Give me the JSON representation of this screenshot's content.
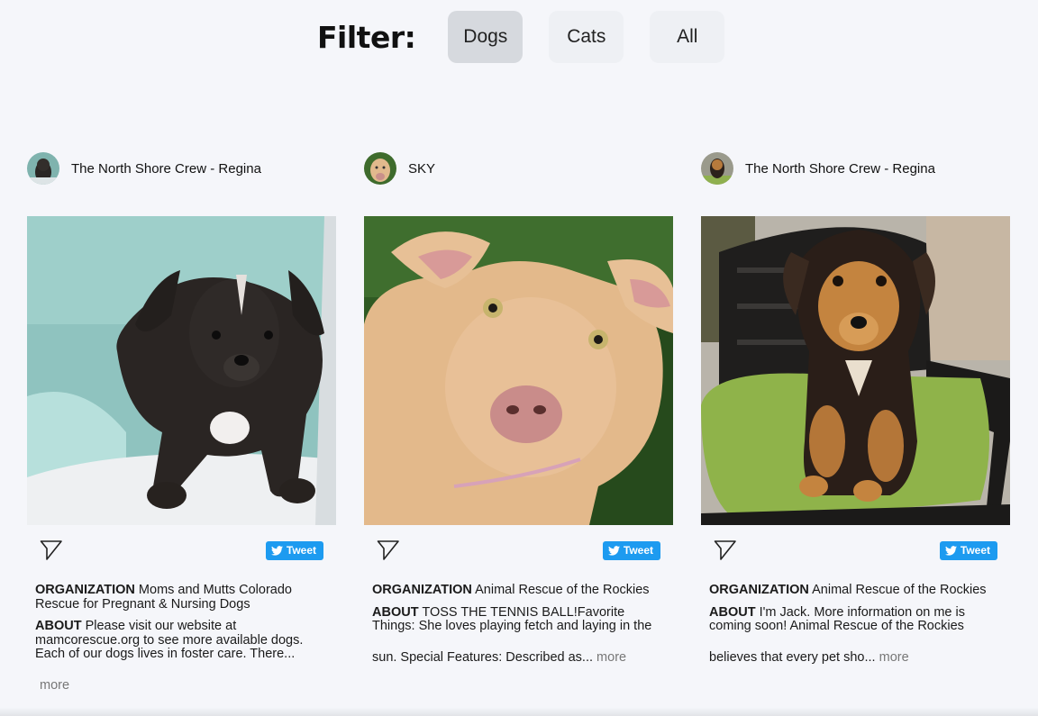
{
  "filter": {
    "label": "Filter:",
    "options": [
      "Dogs",
      "Cats",
      "All"
    ],
    "selected": "Dogs"
  },
  "cards": [
    {
      "org_name": "The North Shore Crew - Regina",
      "tweet_label": "Tweet",
      "organization_label": "ORGANIZATION",
      "organization": "Moms and Mutts Colorado Rescue for Pregnant & Nursing Dogs",
      "about_label": "ABOUT",
      "about": "Please visit our website at mamcorescue.org to see more available dogs. Each of our dogs lives in foster care. There...",
      "more": "more"
    },
    {
      "org_name": "SKY",
      "tweet_label": "Tweet",
      "organization_label": "ORGANIZATION",
      "organization": "Animal Rescue of the Rockies",
      "about_label": "ABOUT",
      "about": "TOSS THE TENNIS BALL!Favorite Things: She loves playing fetch and laying in the",
      "about_cont": "sun. Special Features: Described as...",
      "more": "more"
    },
    {
      "org_name": "The North Shore Crew - Regina",
      "tweet_label": "Tweet",
      "organization_label": "ORGANIZATION",
      "organization": "Animal Rescue of the Rockies",
      "about_label": "ABOUT",
      "about": "I'm Jack. More information on me is coming soon! Animal Rescue of the Rockies",
      "about_cont": "believes that every pet sho...",
      "more": "more"
    }
  ]
}
